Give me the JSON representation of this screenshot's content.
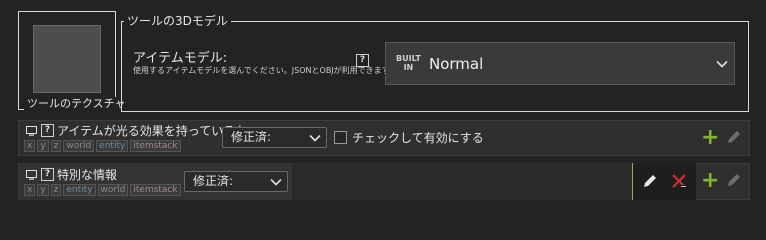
{
  "texture": {
    "label": "ツールのテクスチャ"
  },
  "model": {
    "group_title": "ツールの3Dモデル",
    "title": "アイテムモデル:",
    "description": "使用するアイテムモデルを選んでください。JSONとOBJが利用できます。",
    "help": "?",
    "builtin_badge_line1": "BUILT",
    "builtin_badge_line2": "IN",
    "selected": "Normal"
  },
  "rows": [
    {
      "help": "?",
      "title": "アイテムが光る効果を持っているか",
      "tags": [
        "x",
        "y",
        "z",
        "world",
        "entity",
        "itemstack"
      ],
      "dropdown": "修正済:",
      "checkbox_label": "チェックして有効にする",
      "checked": false
    },
    {
      "help": "?",
      "title": "特別な情報",
      "tags": [
        "x",
        "y",
        "z",
        "entity",
        "world",
        "itemstack"
      ],
      "dropdown": "修正済:"
    }
  ],
  "colors": {
    "accent_green": "#7fb52c",
    "delete_red": "#d03030",
    "background": "#232323"
  }
}
